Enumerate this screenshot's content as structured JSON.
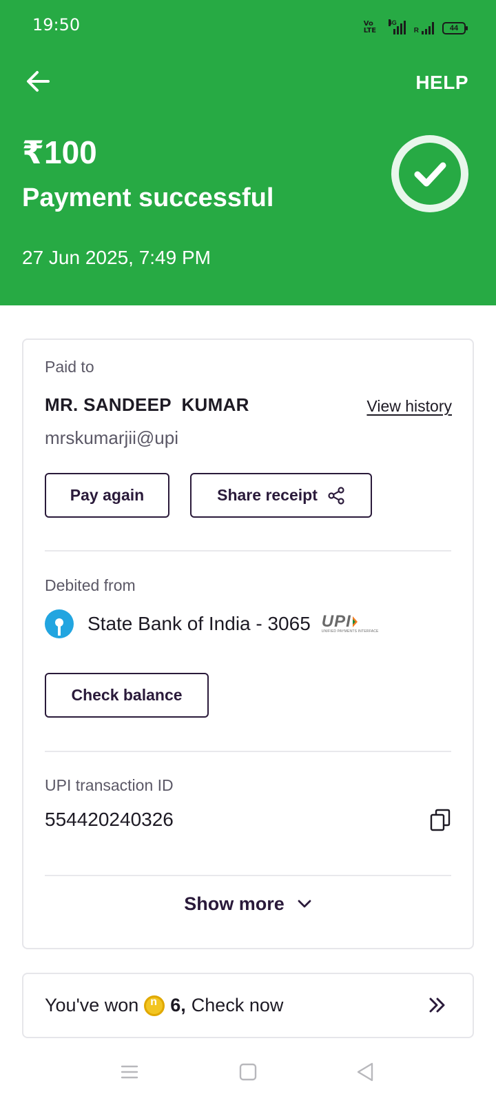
{
  "status_bar": {
    "time": "19:50",
    "volte": "Vo LTE",
    "network": "4G",
    "roaming": "R",
    "battery": "44"
  },
  "header": {
    "help_label": "HELP",
    "amount": "₹100",
    "status": "Payment successful",
    "datetime": "27 Jun 2025, 7:49 PM",
    "accent_color": "#27aa44"
  },
  "paid_to": {
    "label": "Paid to",
    "name": "MR. SANDEEP  KUMAR",
    "view_history": "View history",
    "upi_id": "mrskumarjii@upi",
    "pay_again": "Pay again",
    "share_receipt": "Share receipt"
  },
  "debited_from": {
    "label": "Debited from",
    "bank": "State Bank of India - 3065",
    "upi_logo_text": "UPI",
    "upi_logo_sub": "UNIFIED PAYMENTS INTERFACE",
    "check_balance": "Check balance"
  },
  "transaction": {
    "label": "UPI transaction ID",
    "id": "554420240326"
  },
  "show_more": "Show more",
  "reward": {
    "prefix": "You've won",
    "count": "6,",
    "suffix": "Check now"
  },
  "icons": {
    "back": "arrow-left-icon",
    "success": "check-circle-icon",
    "share": "share-icon",
    "copy": "copy-icon",
    "chevron": "chevron-down-icon",
    "reward_arrow": "double-chevron-right-icon",
    "nav": [
      "menu-icon",
      "home-square-icon",
      "back-triangle-icon"
    ]
  }
}
